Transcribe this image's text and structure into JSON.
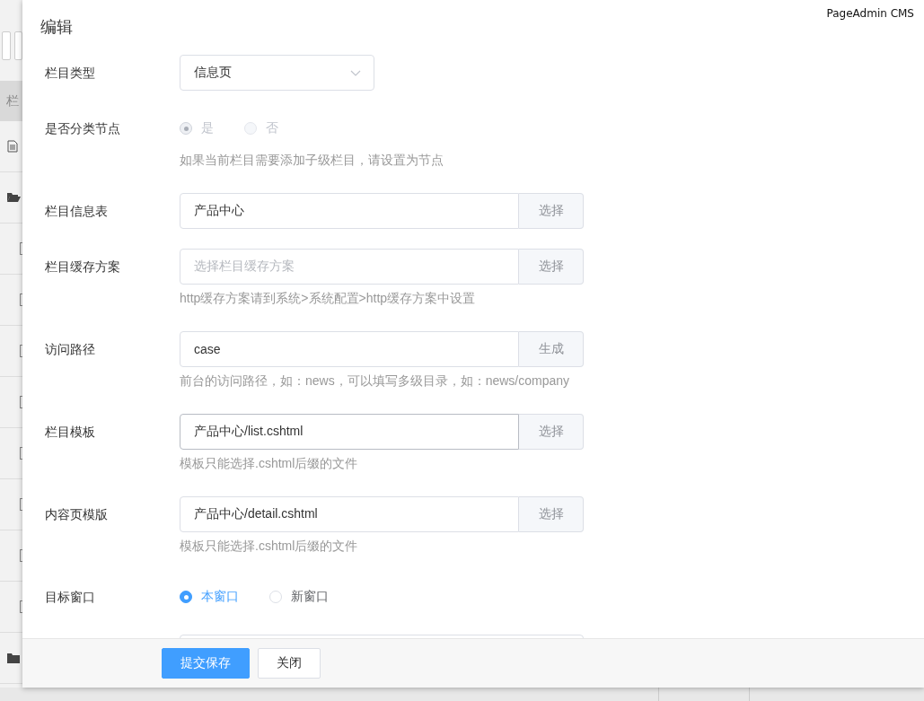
{
  "background": {
    "header": "栏",
    "rows": [
      {
        "kind": "file"
      },
      {
        "kind": "folder-open"
      },
      {
        "kind": "item",
        "checked": false
      },
      {
        "kind": "item",
        "checked": false
      },
      {
        "kind": "item",
        "checked": false
      },
      {
        "kind": "item",
        "checked": false
      },
      {
        "kind": "item",
        "checked": false
      },
      {
        "kind": "item",
        "checked": false
      },
      {
        "kind": "item",
        "checked": false
      },
      {
        "kind": "item",
        "checked": false
      },
      {
        "kind": "folder"
      }
    ]
  },
  "dialog": {
    "title": "编辑",
    "brand": "PageAdmin CMS",
    "fields": [
      {
        "kind": "select",
        "label": "栏目类型",
        "value": "信息页"
      },
      {
        "kind": "radio",
        "label": "是否分类节点",
        "disabled": true,
        "options": [
          {
            "label": "是",
            "selected": true
          },
          {
            "label": "否",
            "selected": false
          }
        ],
        "hint": "如果当前栏目需要添加子级栏目，请设置为节点"
      },
      {
        "kind": "addon",
        "label": "栏目信息表",
        "value": "产品中心",
        "button": "选择",
        "focused": false
      },
      {
        "kind": "addon",
        "label": "栏目缓存方案",
        "placeholder": "选择栏目缓存方案",
        "button": "选择",
        "focused": false,
        "hint": "http缓存方案请到系统>系统配置>http缓存方案中设置"
      },
      {
        "kind": "addon",
        "label": "访问路径",
        "value": "case",
        "button": "生成",
        "focused": false,
        "hint": "前台的访问路径，如：news，可以填写多级目录，如：news/company"
      },
      {
        "kind": "addon",
        "label": "栏目模板",
        "value": "产品中心/list.cshtml",
        "button": "选择",
        "focused": true,
        "hint": "模板只能选择.cshtml后缀的文件"
      },
      {
        "kind": "addon",
        "label": "内容页模版",
        "value": "产品中心/detail.cshtml",
        "button": "选择",
        "focused": false,
        "hint": "模板只能选择.cshtml后缀的文件"
      },
      {
        "kind": "radio",
        "label": "目标窗口",
        "disabled": false,
        "options": [
          {
            "label": "本窗口",
            "selected": true
          },
          {
            "label": "新窗口",
            "selected": false
          }
        ]
      }
    ],
    "buttons": [
      {
        "label": "提交保存",
        "kind": "primary"
      },
      {
        "label": "关闭",
        "kind": "default"
      }
    ]
  }
}
